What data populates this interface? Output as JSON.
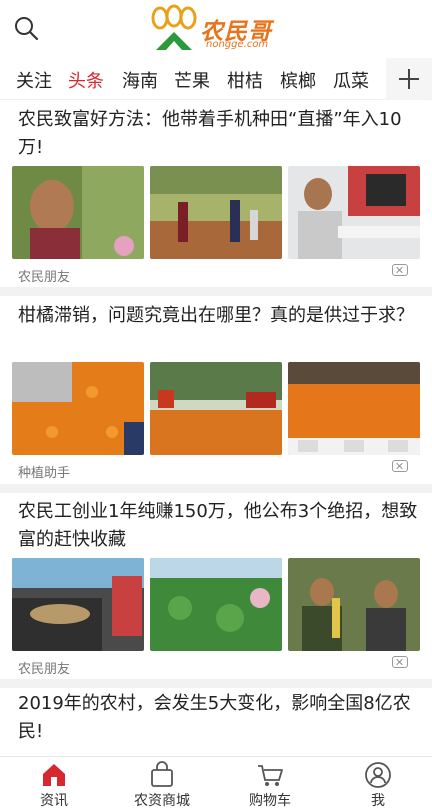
{
  "header": {
    "logo_name": "农民哥",
    "logo_domain": "nongge.com",
    "search_icon": "search-icon"
  },
  "channels": [
    "关注",
    "头条",
    "海南",
    "芒果",
    "柑桔",
    "槟榔",
    "瓜菜"
  ],
  "active_channel": "头条",
  "articles": [
    {
      "title": "农民致富好方法：他带着手机种田“直播”年入10万!",
      "source": "农民朋友"
    },
    {
      "title": "柑橘滞销，问题究竟出在哪里？真的是供过于求？",
      "source": "种植助手"
    },
    {
      "title": "农民工创业1年纯赚150万，他公布3个绝招，想致富的赶快收藏",
      "source": "农民朋友"
    },
    {
      "title": "2019年的农村，会发生5大变化，影响全国8亿农民!",
      "source": ""
    }
  ],
  "tabbar": [
    {
      "label": "资讯",
      "icon": "home-icon"
    },
    {
      "label": "农资商城",
      "icon": "shop-icon"
    },
    {
      "label": "购物车",
      "icon": "cart-icon"
    },
    {
      "label": "我",
      "icon": "user-icon"
    }
  ],
  "colors": {
    "accent": "#d7282f",
    "brand": "#e8731a",
    "logo_green": "#2a9a3a"
  }
}
